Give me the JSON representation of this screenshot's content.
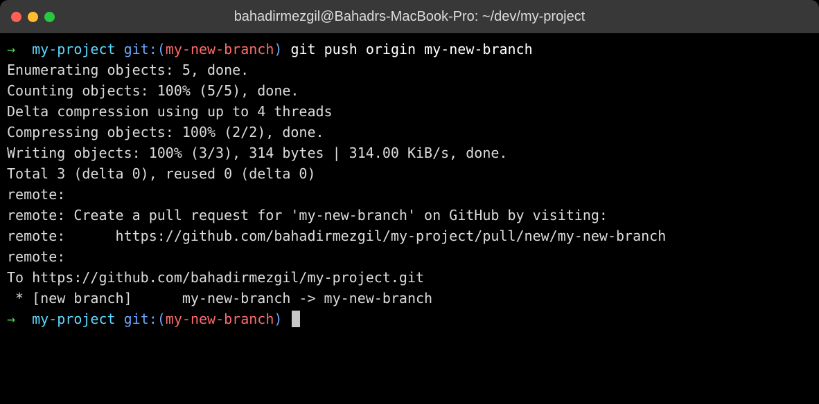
{
  "titlebar": {
    "title": "bahadirmezgil@Bahadrs-MacBook-Pro: ~/dev/my-project"
  },
  "prompt": {
    "arrow": "→",
    "directory": "my-project",
    "git_prefix": "git:(",
    "branch": "my-new-branch",
    "git_suffix": ")",
    "command": "git push origin my-new-branch"
  },
  "output": {
    "l1": "Enumerating objects: 5, done.",
    "l2": "Counting objects: 100% (5/5), done.",
    "l3": "Delta compression using up to 4 threads",
    "l4": "Compressing objects: 100% (2/2), done.",
    "l5": "Writing objects: 100% (3/3), 314 bytes | 314.00 KiB/s, done.",
    "l6": "Total 3 (delta 0), reused 0 (delta 0)",
    "l7": "remote: ",
    "l8": "remote: Create a pull request for 'my-new-branch' on GitHub by visiting:",
    "l9": "remote:      https://github.com/bahadirmezgil/my-project/pull/new/my-new-branch",
    "l10": "remote: ",
    "l11": "To https://github.com/bahadirmezgil/my-project.git",
    "l12": " * [new branch]      my-new-branch -> my-new-branch"
  }
}
